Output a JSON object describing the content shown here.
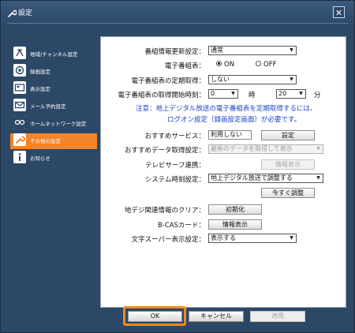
{
  "window": {
    "title": "設定",
    "close_label": "✕"
  },
  "sidebar": {
    "items": [
      {
        "label": "地域/チャンネル設定",
        "icon": "antenna-icon",
        "active": false
      },
      {
        "label": "録画設定",
        "icon": "record-icon",
        "active": false
      },
      {
        "label": "表示設定",
        "icon": "display-icon",
        "active": false
      },
      {
        "label": "メール予約設定",
        "icon": "mail-icon",
        "active": false
      },
      {
        "label": "ホームネットワーク設定",
        "icon": "network-icon",
        "active": false
      },
      {
        "label": "その他の設定",
        "icon": "wrench-icon",
        "active": true
      },
      {
        "label": "お知らせ",
        "icon": "info-icon",
        "active": false
      }
    ]
  },
  "form": {
    "epg_update_label": "番組情報更新設定：",
    "epg_update_value": "通常",
    "epg_label": "電子番組表：",
    "epg_on": "ON",
    "epg_off": "OFF",
    "epg_periodic_label": "電子番組表の定期取得：",
    "epg_periodic_value": "しない",
    "epg_start_label": "電子番組表の取得開始時刻：",
    "hour_value": "0",
    "hour_unit": "時",
    "minute_value": "20",
    "minute_unit": "分",
    "note_line1": "注意：地上デジタル放送の電子番組表を定期取得するには、",
    "note_line2": "ログオン設定（録画設定画面）が必要です。",
    "recommend_label": "おすすめサービス：",
    "recommend_value": "利用しない",
    "recommend_button": "設定",
    "recommend_data_label": "おすすめデータ取得設定：",
    "recommend_data_value": "最新のデータを取得して表示",
    "telesurf_label": "テレビサーフ連携：",
    "telesurf_button": "情報表示",
    "clock_label": "システム時刻設定：",
    "clock_value": "地上デジタル放送で調整する",
    "adjust_now_button": "今すぐ調整",
    "clear_label": "地デジ関連情報のクリア：",
    "clear_button": "初期化",
    "bcas_label": "B-CASカード：",
    "bcas_button": "情報表示",
    "superimpose_label": "文字スーパー表示設定：",
    "superimpose_value": "表示する"
  },
  "footer": {
    "ok": "OK",
    "cancel": "キャンセル",
    "apply": "適用"
  }
}
